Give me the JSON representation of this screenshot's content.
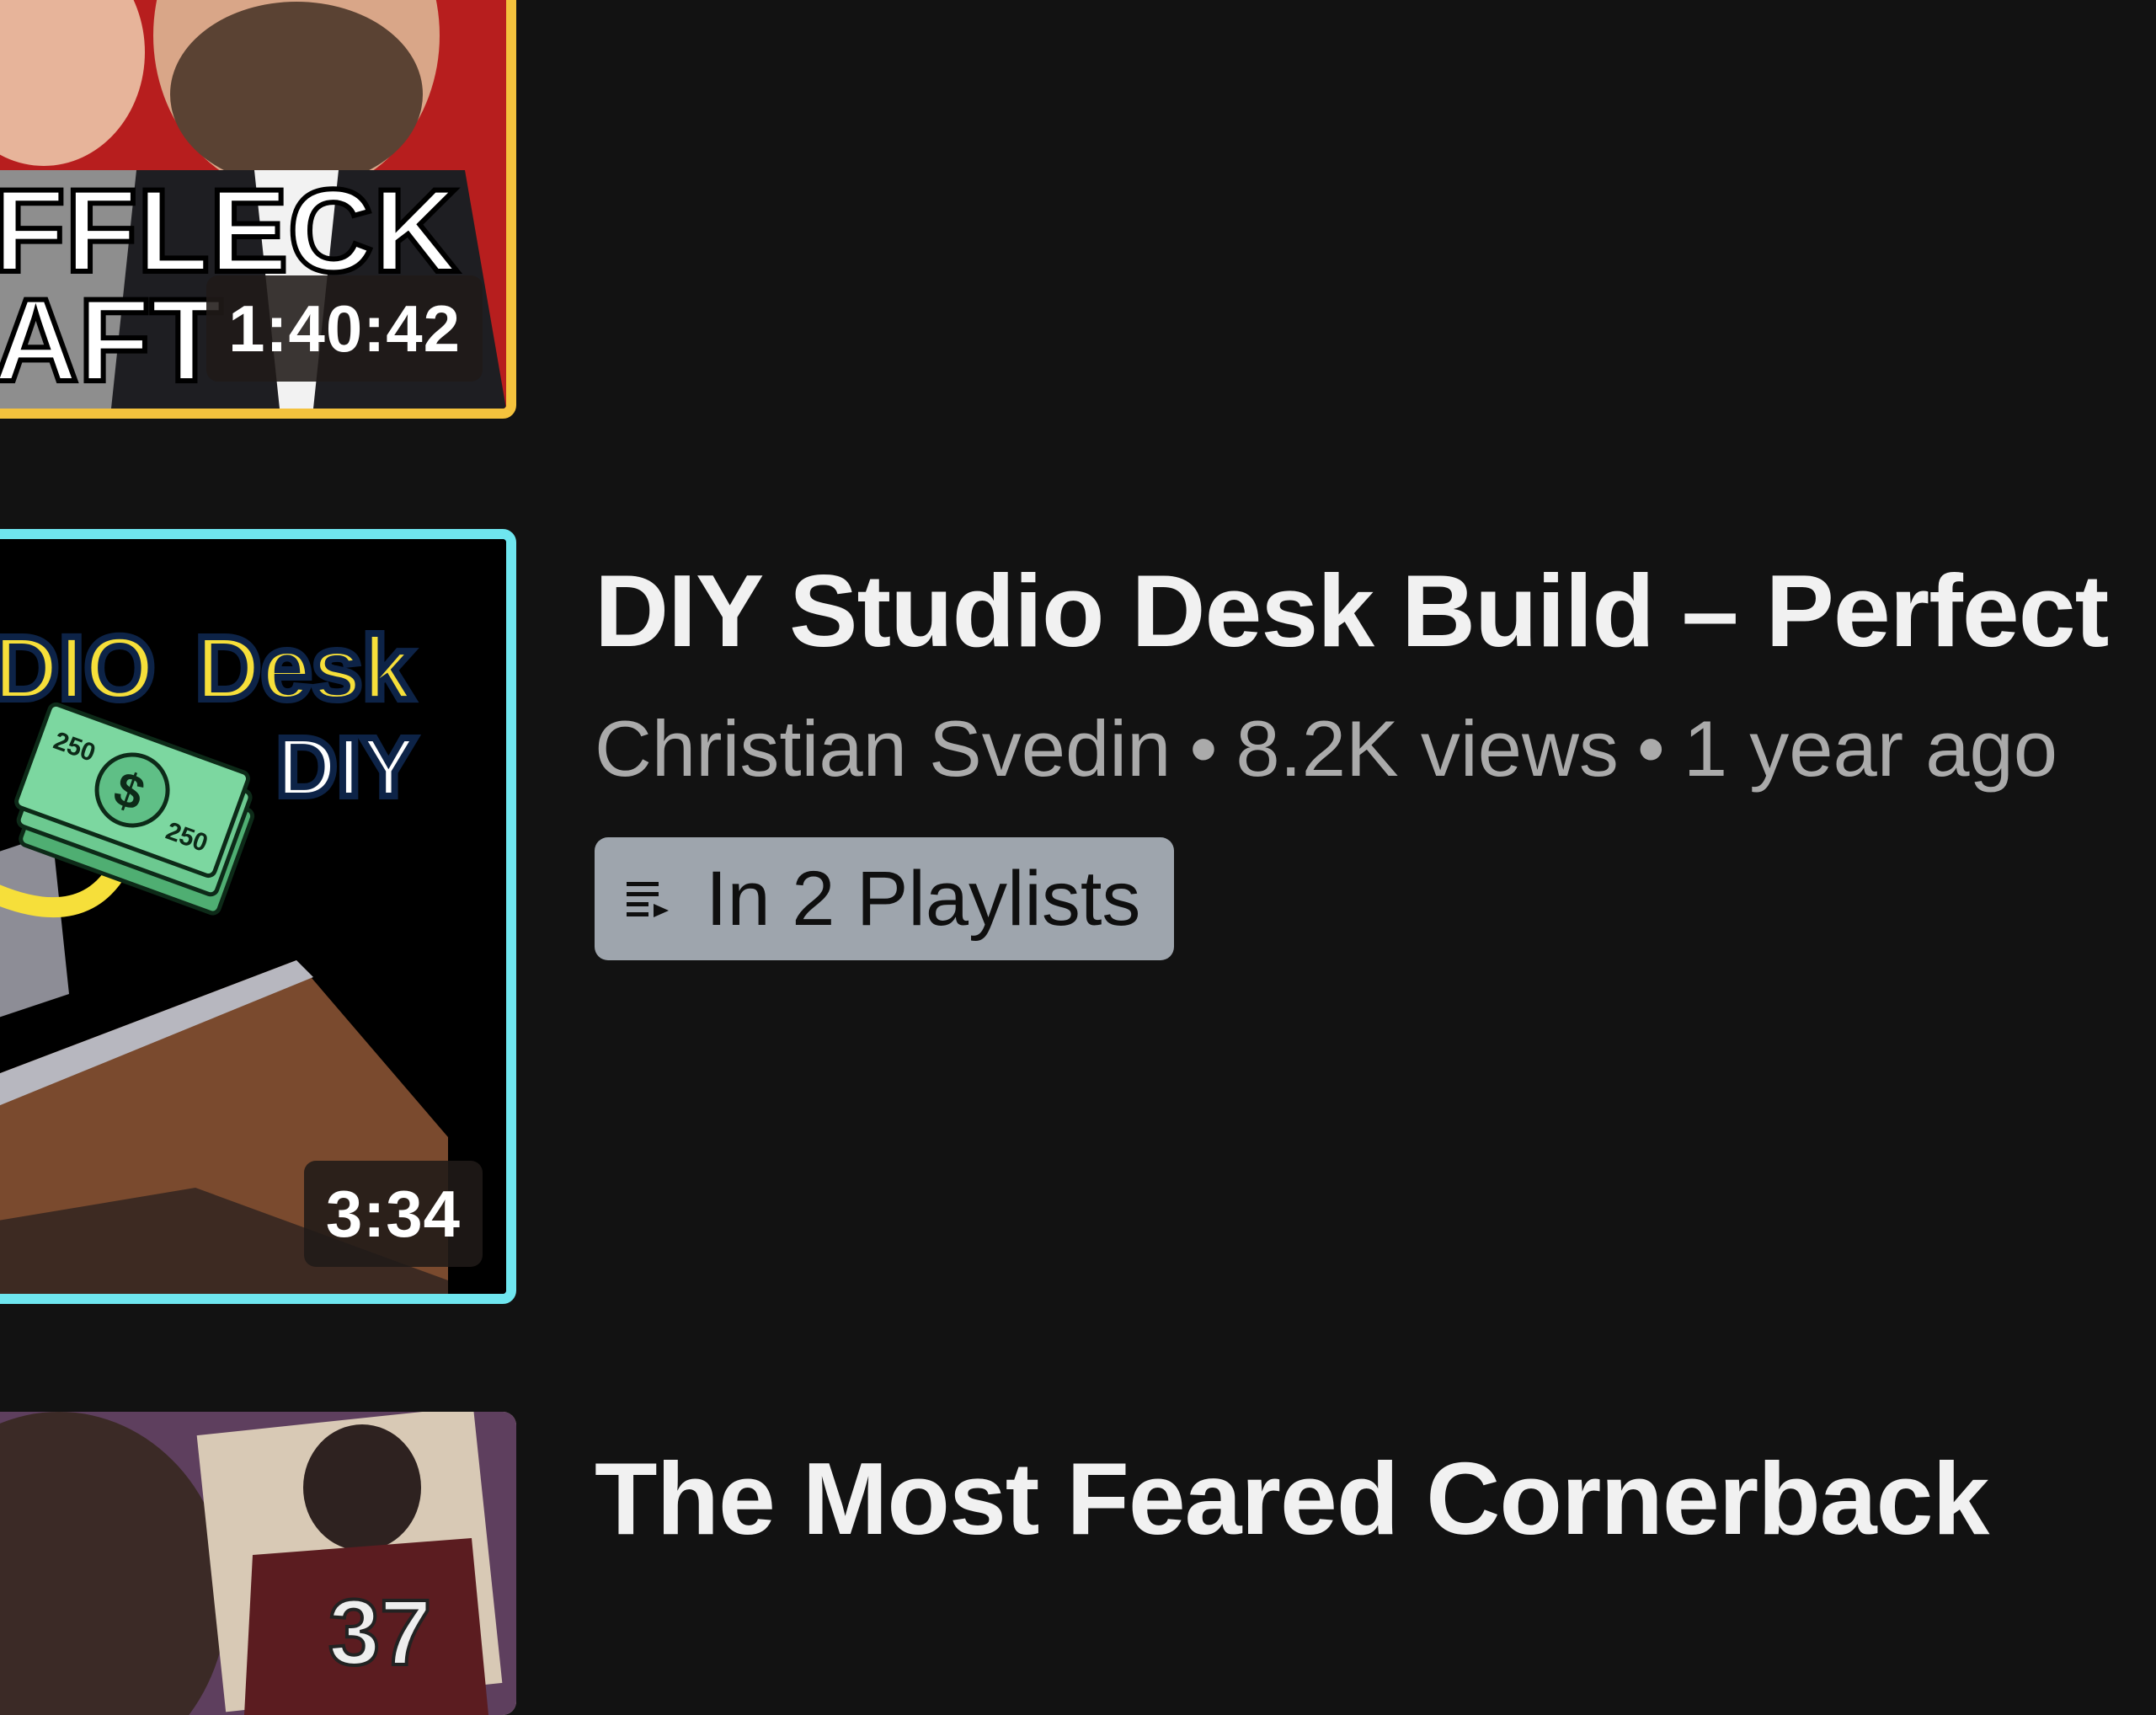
{
  "videos": [
    {
      "thumbnail_text": [
        "FFLECK",
        "AFT"
      ],
      "duration": "1:40:42",
      "border_color": "#f4c23d"
    },
    {
      "title": "DIY Studio Desk Build – Perfect",
      "channel": "Christian Svedin",
      "separator": "•",
      "views": "8.2K views",
      "age": "1 year ago",
      "playlist_badge": "In 2 Playlists",
      "playlist_icon": "playlist-icon",
      "thumbnail_text": [
        "DIO",
        "Desk",
        "DIY",
        "250",
        "$",
        "250"
      ],
      "duration": "3:34",
      "border_color": "#6fe6ef"
    },
    {
      "title": "The Most Feared Cornerback",
      "thumbnail_text": [
        "37"
      ]
    }
  ],
  "colors": {
    "background": "#121212",
    "title": "#f1f1f1",
    "meta": "#aaaaaa",
    "badge_bg": "#9ea5ad"
  }
}
